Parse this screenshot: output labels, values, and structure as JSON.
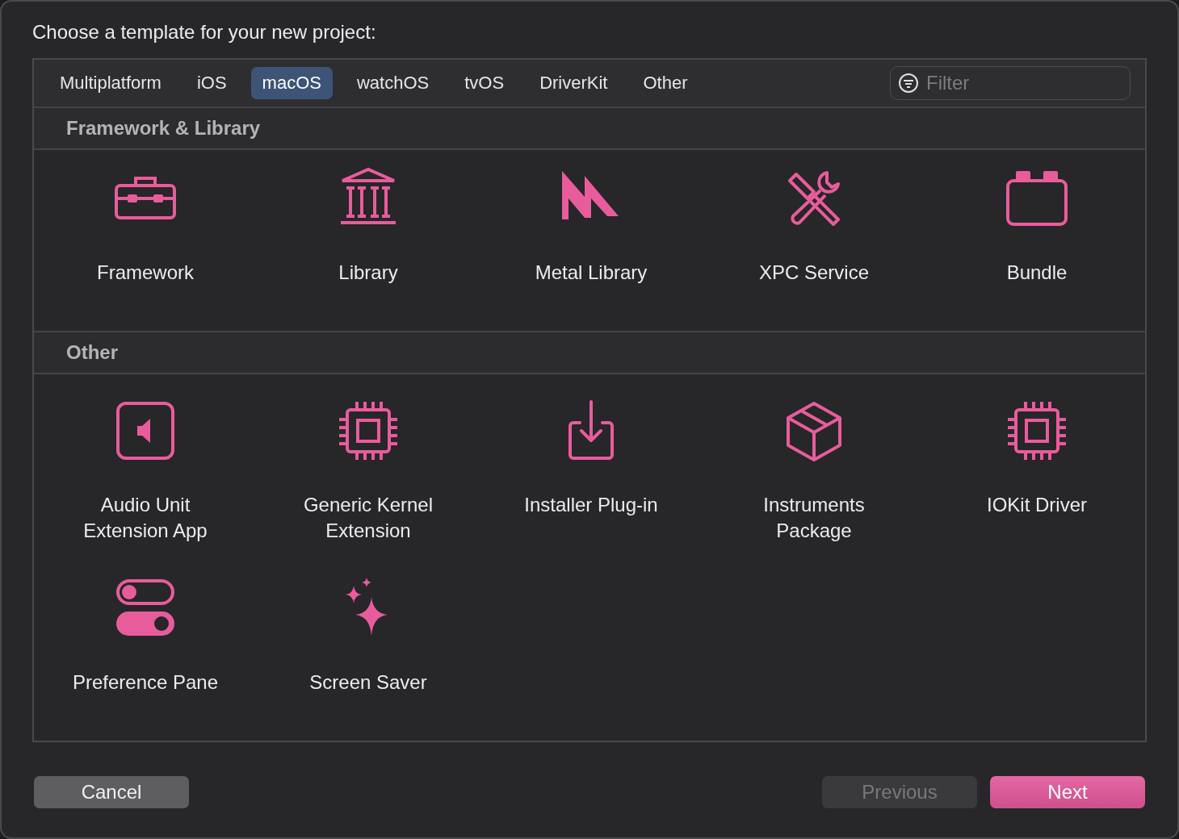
{
  "title": "Choose a template for your new project:",
  "tabs": [
    {
      "label": "Multiplatform",
      "selected": false
    },
    {
      "label": "iOS",
      "selected": false
    },
    {
      "label": "macOS",
      "selected": true
    },
    {
      "label": "watchOS",
      "selected": false
    },
    {
      "label": "tvOS",
      "selected": false
    },
    {
      "label": "DriverKit",
      "selected": false
    },
    {
      "label": "Other",
      "selected": false
    }
  ],
  "filter": {
    "placeholder": "Filter"
  },
  "sections": [
    {
      "title": "Framework & Library",
      "templates": [
        {
          "label": "Framework",
          "kind": "toolbox"
        },
        {
          "label": "Library",
          "kind": "columns"
        },
        {
          "label": "Metal Library",
          "kind": "zigzag"
        },
        {
          "label": "XPC Service",
          "kind": "tools"
        },
        {
          "label": "Bundle",
          "kind": "container"
        }
      ]
    },
    {
      "title": "Other",
      "templates": [
        {
          "label": "Audio Unit Extension App",
          "kind": "speaker"
        },
        {
          "label": "Generic Kernel Extension",
          "kind": "chip"
        },
        {
          "label": "Installer Plug-in",
          "kind": "tray"
        },
        {
          "label": "Instruments Package",
          "kind": "cube"
        },
        {
          "label": "IOKit Driver",
          "kind": "chip"
        },
        {
          "label": "Preference Pane",
          "kind": "toggles"
        },
        {
          "label": "Screen Saver",
          "kind": "sparkles"
        }
      ]
    }
  ],
  "buttons": [
    {
      "label": "Cancel",
      "kind": "plain",
      "disabled": false
    },
    {
      "label": "Previous",
      "kind": "plain",
      "disabled": true
    },
    {
      "label": "Next",
      "kind": "primary",
      "disabled": false
    }
  ]
}
